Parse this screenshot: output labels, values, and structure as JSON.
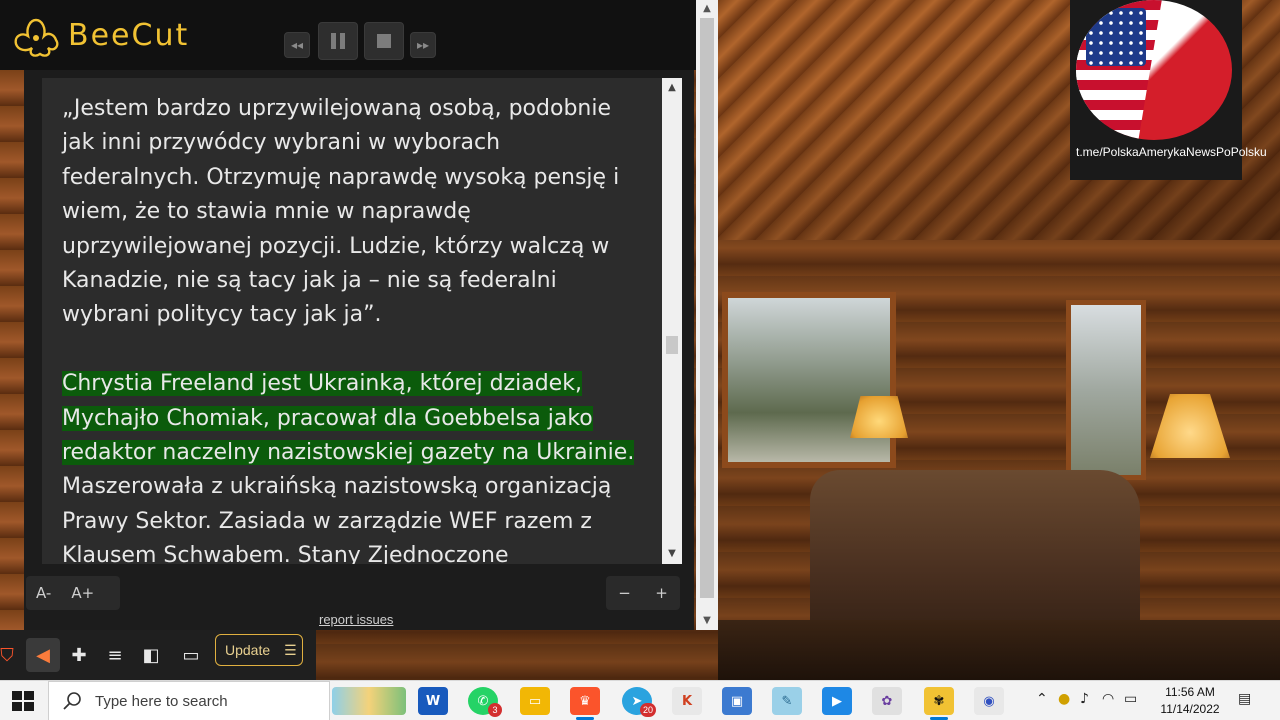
{
  "app": {
    "name": "BeeCut"
  },
  "media_controls": {
    "rewind_icon": "rewind-icon",
    "pause_icon": "pause-icon",
    "stop_icon": "stop-icon",
    "forward_icon": "forward-icon"
  },
  "channel": {
    "text": "t.me/PolskaAmerykaNewsPoPolsku"
  },
  "reader": {
    "paragraphs": [
      {
        "text": "„Jestem bardzo uprzywilejowaną osobą, podobnie jak inni przywódcy wybrani w wyborach federalnych. Otrzymuję naprawdę wysoką pensję i wiem, że to stawia mnie w naprawdę uprzywilejowanej pozycji. Ludzie, którzy walczą w Kanadzie, nie są tacy jak ja – nie są federalni wybrani politycy tacy jak ja”."
      },
      {
        "highlight": "Chrystia Freeland jest Ukrainką, której dziadek, Mychajło Chomiak, pracował dla Goebbelsa jako redaktor naczelny nazistowskiej gazety na Ukrainie.",
        "rest": " Maszerowała z ukraińską nazistowską organizacją Prawy Sektor. Zasiada w zarządzie WEF razem z Klausem Schwabem. Stany Zjednoczone"
      }
    ],
    "font_decrease": "A-",
    "font_increase": "A+",
    "zoom_out": "−",
    "zoom_in": "+",
    "report_link": "report issues"
  },
  "browser_toolbar": {
    "update_label": "Update",
    "icons": [
      "brave-lion-icon",
      "speaker-icon",
      "extensions-icon",
      "playlist-icon",
      "sidebar-icon",
      "wallet-icon",
      "menu-icon"
    ]
  },
  "taskbar": {
    "search_placeholder": "Type here to search",
    "whatsapp_badge": "3",
    "telegram_badge": "20",
    "time": "11:56 AM",
    "date": "11/14/2022"
  },
  "colors": {
    "accent": "#f1c233",
    "highlight": "#0b5b0b",
    "taskbar_active": "#0078d4"
  }
}
